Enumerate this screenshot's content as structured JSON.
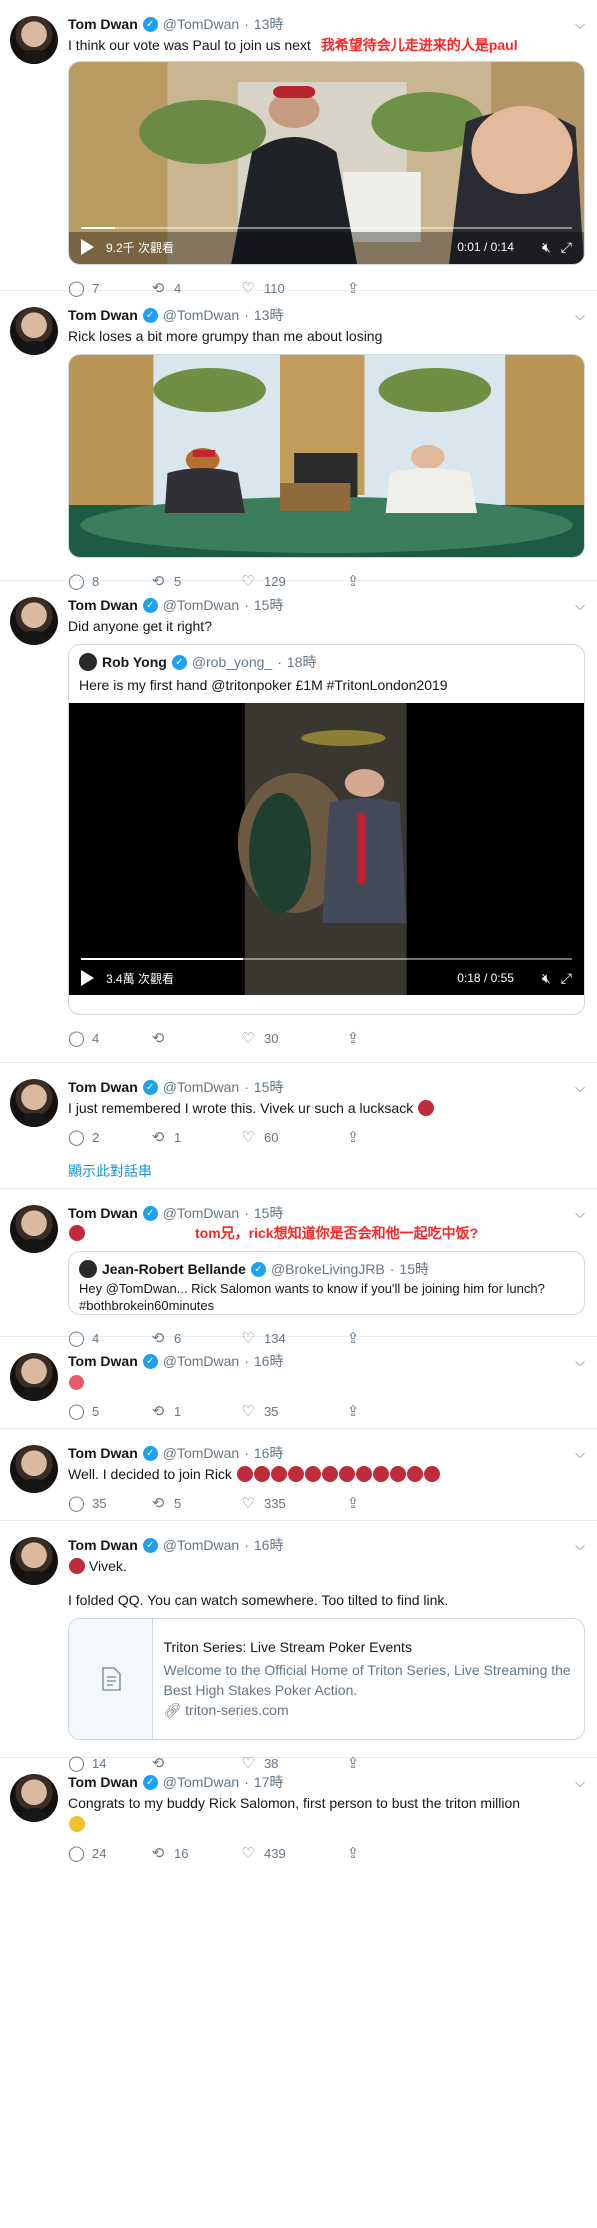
{
  "tweets": [
    {
      "name": "Tom Dwan",
      "handle": "@TomDwan",
      "time": "13時",
      "text": "I think our vote was Paul to join us next",
      "annotation": "我希望待会儿走进来的人是paul",
      "video": {
        "views": "9.2千 次觀看",
        "time": "0:01 / 0:14",
        "progress": 0.07
      },
      "replies": "7",
      "retweets": "4",
      "likes": "110"
    },
    {
      "name": "Tom Dwan",
      "handle": "@TomDwan",
      "time": "13時",
      "text": "Rick loses a bit more grumpy than me about losing",
      "replies": "8",
      "retweets": "5",
      "likes": "129"
    },
    {
      "name": "Tom Dwan",
      "handle": "@TomDwan",
      "time": "15時",
      "text": "Did anyone get it right?",
      "quote": {
        "name": "Rob Yong",
        "handle": "@rob_yong_",
        "time": "18時",
        "text": "Here is my first hand @tritonpoker £1M #TritonLondon2019",
        "video": {
          "views": "3.4萬 次觀看",
          "time": "0:18 / 0:55",
          "progress": 0.33
        }
      },
      "replies": "4",
      "retweets": "",
      "likes": "30"
    },
    {
      "name": "Tom Dwan",
      "handle": "@TomDwan",
      "time": "15時",
      "text": "I just remembered I wrote this. Vivek ur such a lucksack",
      "replies": "2",
      "retweets": "1",
      "likes": "60",
      "show_thread": "顯示此對話串"
    },
    {
      "name": "Tom Dwan",
      "handle": "@TomDwan",
      "time": "15時",
      "annotation": "tom兄，rick想知道你是否会和他一起吃中饭?",
      "quote": {
        "name": "Jean-Robert Bellande",
        "handle": "@BrokeLivingJRB",
        "time": "15時",
        "text": "Hey @TomDwan... Rick Salomon wants to know if you'll be joining him for lunch? #bothbrokein60minutes"
      },
      "replies": "4",
      "retweets": "6",
      "likes": "134"
    },
    {
      "name": "Tom Dwan",
      "handle": "@TomDwan",
      "time": "16時",
      "replies": "5",
      "retweets": "1",
      "likes": "35"
    },
    {
      "name": "Tom Dwan",
      "handle": "@TomDwan",
      "time": "16時",
      "text": "Well. I decided to join Rick",
      "replies": "35",
      "retweets": "5",
      "likes": "335"
    },
    {
      "name": "Tom Dwan",
      "handle": "@TomDwan",
      "time": "16時",
      "text": "Vivek.",
      "text2": "I folded QQ. You can watch somewhere. Too tilted to find link.",
      "card": {
        "title": "Triton Series: Live Stream Poker Events",
        "desc": "Welcome to the Official Home of Triton Series, Live Streaming the Best High Stakes Poker Action.",
        "domain": "triton-series.com"
      },
      "replies": "14",
      "retweets": "",
      "likes": "38"
    },
    {
      "name": "Tom Dwan",
      "handle": "@TomDwan",
      "time": "17時",
      "text": "Congrats to my buddy Rick Salomon, first person to bust the triton million",
      "replies": "24",
      "retweets": "16",
      "likes": "439"
    }
  ],
  "icons": {
    "reply": "reply-icon",
    "retweet": "retweet-icon",
    "like": "heart-icon",
    "share": "share-icon"
  },
  "colors": {
    "link": "#1b95e0",
    "verified": "#1da1f2",
    "annotation": "#ff2525",
    "muted": "#657786"
  }
}
